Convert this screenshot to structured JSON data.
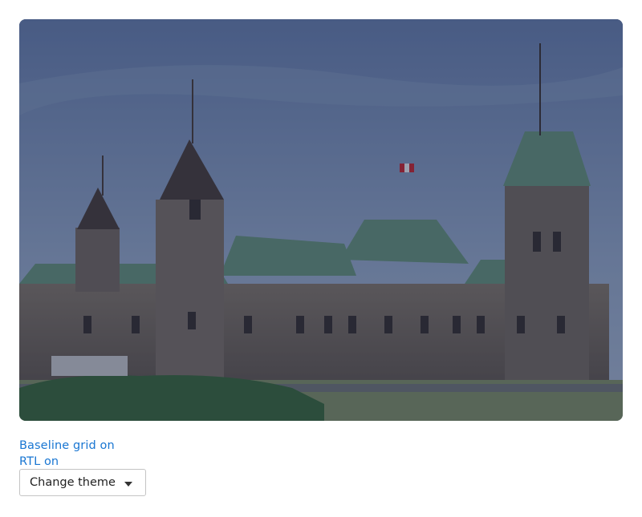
{
  "image": {
    "alt": "Centre Block, Parliament Hill"
  },
  "controls": {
    "baseline_grid_label": "Baseline grid on",
    "rtl_label": "RTL on",
    "theme_select_label": "Change theme"
  },
  "colors": {
    "link": "#1976d2",
    "overlay": "#122040"
  },
  "icons": {
    "theme_caret": "chevron-down-icon"
  }
}
